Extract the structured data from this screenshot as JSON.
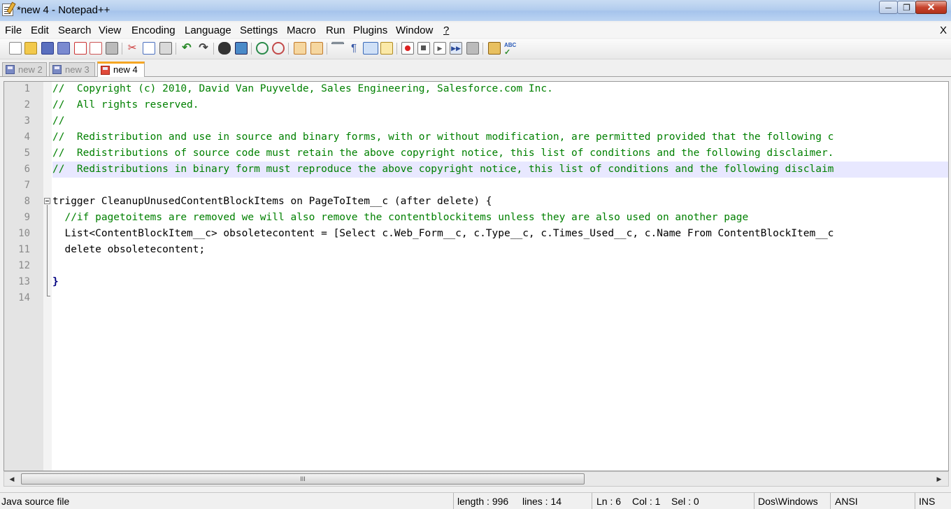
{
  "window": {
    "title": "*new  4 - Notepad++"
  },
  "menu": [
    "File",
    "Edit",
    "Search",
    "View",
    "Encoding",
    "Language",
    "Settings",
    "Macro",
    "Run",
    "Plugins",
    "Window",
    "?"
  ],
  "menu_close": "X",
  "toolbar_icons": [
    "new-file-icon",
    "open-file-icon",
    "save-icon",
    "save-all-icon",
    "close-icon",
    "close-all-icon",
    "print-icon",
    "cut-icon",
    "copy-icon",
    "paste-icon",
    "undo-icon",
    "redo-icon",
    "find-icon",
    "replace-icon",
    "zoom-in-icon",
    "zoom-out-icon",
    "sync-vertical-icon",
    "sync-horizontal-icon",
    "word-wrap-icon",
    "show-all-chars-icon",
    "indent-guide-icon",
    "doc-map-icon",
    "record-macro-icon",
    "stop-record-icon",
    "play-macro-icon",
    "run-macro-multiple-icon",
    "save-macro-icon",
    "launch-browser-icon",
    "spell-check-icon"
  ],
  "tabs": [
    {
      "label": "new 2",
      "active": false
    },
    {
      "label": "new 3",
      "active": false
    },
    {
      "label": "new 4",
      "active": true
    }
  ],
  "editor": {
    "lines": [
      {
        "n": "1",
        "text": "//  Copyright (c) 2010, David Van Puyvelde, Sales Engineering, Salesforce.com Inc."
      },
      {
        "n": "2",
        "text": "//  All rights reserved."
      },
      {
        "n": "3",
        "text": "//"
      },
      {
        "n": "4",
        "text": "//  Redistribution and use in source and binary forms, with or without modification, are permitted provided that the following c"
      },
      {
        "n": "5",
        "text": "//  Redistributions of source code must retain the above copyright notice, this list of conditions and the following disclaimer."
      },
      {
        "n": "6",
        "text": "//  Redistributions in binary form must reproduce the above copyright notice, this list of conditions and the following disclaim"
      },
      {
        "n": "7",
        "text": ""
      },
      {
        "n": "8",
        "text": "trigger CleanupUnusedContentBlockItems on PageToItem__c (after delete) {"
      },
      {
        "n": "9",
        "text": "  //if pagetoitems are removed we will also remove the contentblockitems unless they are also used on another page"
      },
      {
        "n": "10",
        "text": "  List<ContentBlockItem__c> obsoletecontent = [Select c.Web_Form__c, c.Type__c, c.Times_Used__c, c.Name From ContentBlockItem__c"
      },
      {
        "n": "11",
        "text": "  delete obsoletecontent;"
      },
      {
        "n": "12",
        "text": ""
      },
      {
        "n": "13",
        "text": "}"
      },
      {
        "n": "14",
        "text": ""
      }
    ],
    "current_line": "6"
  },
  "scrollbar": {
    "grip": "III"
  },
  "status": {
    "file_type": "Java source file",
    "length": "length : 996",
    "lines": "lines : 14",
    "ln": "Ln : 6",
    "col": "Col : 1",
    "sel": "Sel : 0",
    "eol": "Dos\\Windows",
    "encoding": "ANSI",
    "mode": "INS"
  },
  "colors": {
    "comment": "#008000",
    "operator": "#000080",
    "current_line_bg": "#e8e8ff",
    "active_tab_accent": "#f5a623"
  }
}
